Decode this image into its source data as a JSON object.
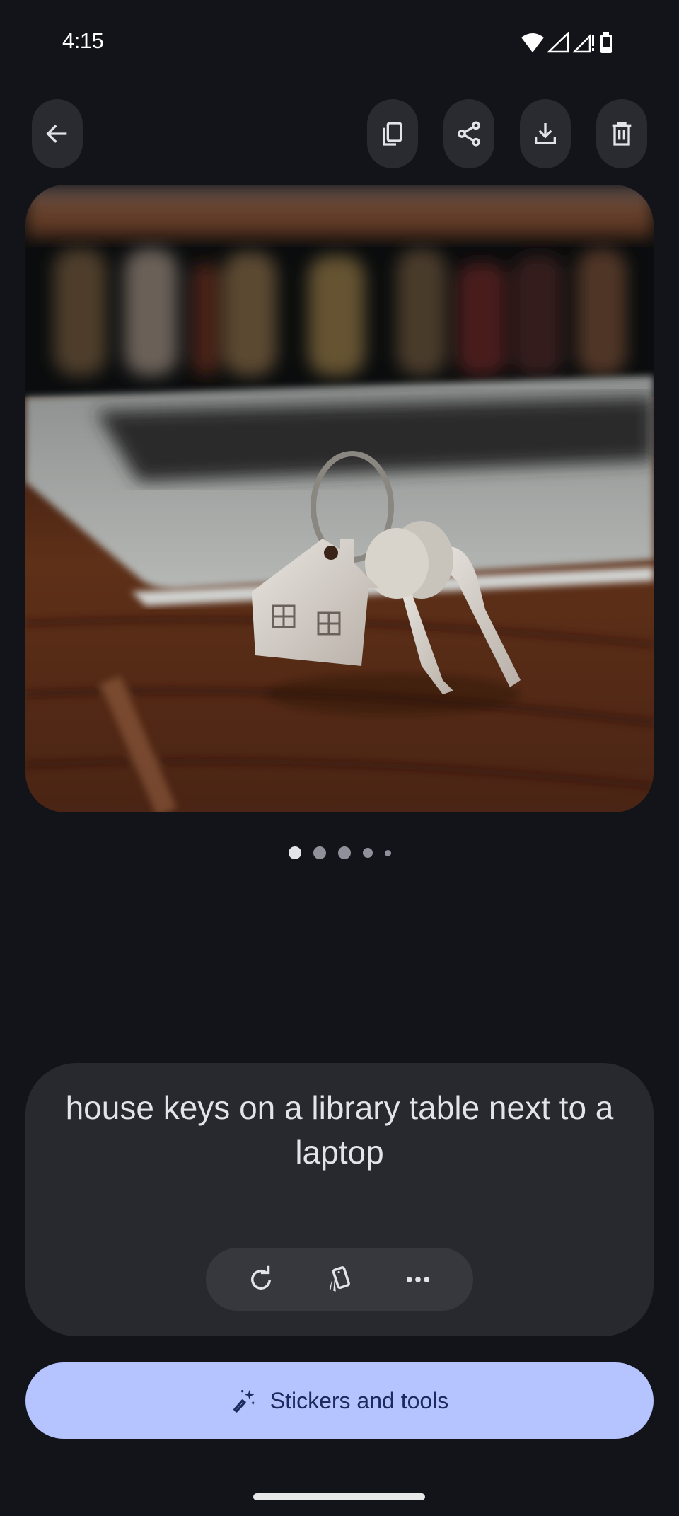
{
  "status_bar": {
    "time": "4:15",
    "icons": [
      "wifi-icon",
      "signal-icon",
      "signal-no-data-icon",
      "battery-icon"
    ]
  },
  "toolbar": {
    "back": {
      "icon": "arrow-back-icon",
      "label": "Back"
    },
    "actions": [
      {
        "icon": "copy-icon",
        "label": "Copy"
      },
      {
        "icon": "share-icon",
        "label": "Share"
      },
      {
        "icon": "download-icon",
        "label": "Download"
      },
      {
        "icon": "delete-icon",
        "label": "Delete"
      }
    ]
  },
  "image": {
    "alt": "house keys on a library table next to a laptop"
  },
  "pager": {
    "count": 5,
    "active_index": 0
  },
  "prompt": {
    "text": "house keys on a library table next to a laptop",
    "actions": [
      {
        "icon": "refresh-icon",
        "label": "Regenerate"
      },
      {
        "icon": "cards-icon",
        "label": "Variations"
      },
      {
        "icon": "more-horiz-icon",
        "label": "More options"
      }
    ]
  },
  "stickers_button": {
    "icon": "magic-wand-icon",
    "label": "Stickers and tools"
  },
  "colors": {
    "background": "#131419",
    "surface": "#28292e",
    "button_bg": "#2a2b30",
    "accent": "#b5c3ff",
    "accent_text": "#1c2a5e"
  }
}
